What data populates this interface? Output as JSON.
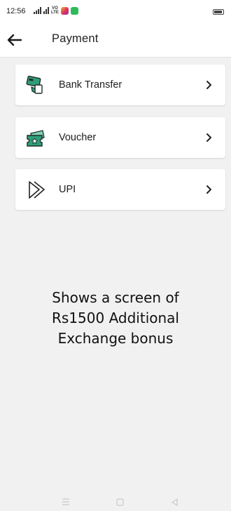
{
  "status_bar": {
    "time": "12:56",
    "volte_top": "VO",
    "volte_bottom": "LTE",
    "icons": [
      "signal-icon",
      "volte-icon",
      "instagram-icon",
      "whatsapp-icon",
      "battery-icon"
    ]
  },
  "header": {
    "title": "Payment",
    "back_icon": "arrow-left-icon"
  },
  "options": [
    {
      "label": "Bank Transfer",
      "icon": "bank-transfer-icon",
      "chevron": "chevron-right-icon"
    },
    {
      "label": "Voucher",
      "icon": "voucher-icon",
      "chevron": "chevron-right-icon"
    },
    {
      "label": "UPI",
      "icon": "upi-icon",
      "chevron": "chevron-right-icon"
    }
  ],
  "overlay_text": "Shows a screen of Rs1500 Additional Exchange bonus",
  "nav_bar": [
    "menu-icon",
    "home-icon",
    "back-triangle-icon"
  ],
  "colors": {
    "background": "#f1f1f1",
    "card": "#ffffff",
    "icon_green": "#2e9e7a",
    "icon_dark": "#2b2b2b"
  }
}
